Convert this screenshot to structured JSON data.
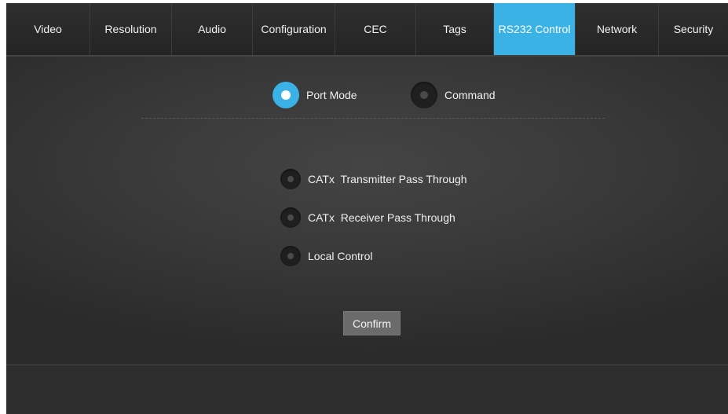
{
  "tabs": [
    {
      "label": "Video",
      "active": false
    },
    {
      "label": "Resolution",
      "active": false
    },
    {
      "label": "Audio",
      "active": false
    },
    {
      "label": "Configuration",
      "active": false
    },
    {
      "label": "CEC",
      "active": false
    },
    {
      "label": "Tags",
      "active": false
    },
    {
      "label": "RS232 Control",
      "active": true
    },
    {
      "label": "Network",
      "active": false
    },
    {
      "label": "Security",
      "active": false
    }
  ],
  "mode": {
    "options": [
      {
        "label": "Port Mode",
        "selected": true
      },
      {
        "label": "Command",
        "selected": false
      }
    ]
  },
  "port_options": [
    {
      "label": "CATx  Transmitter Pass Through",
      "selected": false
    },
    {
      "label": "CATx  Receiver Pass Through",
      "selected": false
    },
    {
      "label": "Local Control",
      "selected": false
    }
  ],
  "confirm_label": "Confirm",
  "colors": {
    "accent": "#3bb2e6",
    "background": "#2d2d2d",
    "button": "#6b6b6b"
  }
}
